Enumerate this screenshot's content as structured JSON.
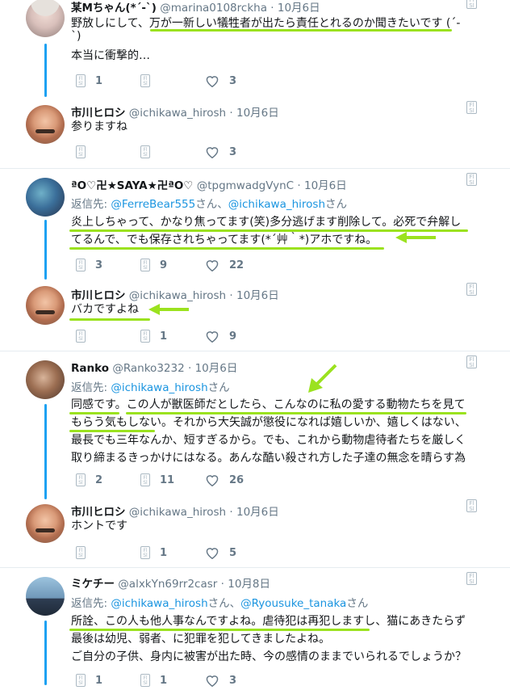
{
  "tweets": [
    {
      "name": "某Mちゃん(*´-`)",
      "handle": "@marina0108rckha",
      "date": "10月6日",
      "reply_prefix": "",
      "reply_users": [],
      "lines": [
        "野放しにして、万が一新しい犠牲者が出たら責任とれるのか聞きたいです (´-",
        "`)",
        "本当に衝撃的…"
      ],
      "reply_count": "1",
      "retweet_count": "",
      "like_count": "3"
    },
    {
      "name": "市川ヒロシ",
      "handle": "@ichikawa_hirosh",
      "date": "10月6日",
      "lines": [
        "参りますね"
      ],
      "reply_count": "",
      "retweet_count": "",
      "like_count": "3"
    },
    {
      "name": "ªO♡卍★SAYA★卍ªO♡",
      "handle": "@tpgmwadgVynC",
      "date": "10月6日",
      "reply_prefix": "返信先: ",
      "reply_users": [
        "@FerreBear555",
        "さん、",
        "@ichikawa_hirosh",
        "さん"
      ],
      "lines": [
        "炎上しちゃって、かなり焦ってます(笑)多分逃げます削除して。必死で弁解し",
        "てるんで、でも保存されちゃってます(*´艸｀*)アホですね。"
      ],
      "reply_count": "3",
      "retweet_count": "9",
      "like_count": "22"
    },
    {
      "name": "市川ヒロシ",
      "handle": "@ichikawa_hirosh",
      "date": "10月6日",
      "lines": [
        "バカですよね"
      ],
      "reply_count": "",
      "retweet_count": "1",
      "like_count": "9"
    },
    {
      "name": "Ranko",
      "handle": "@Ranko3232",
      "date": "10月6日",
      "reply_prefix": "返信先: ",
      "reply_users": [
        "@ichikawa_hirosh",
        "さん"
      ],
      "lines": [
        "同感です。この人が獣医師だとしたら、こんなのに私の愛する動物たちを見て",
        "もらう気もしない。それから大矢誠が懲役になれば嬉しいか、嬉しくはない、",
        "最長でも三年なんか、短すぎるから。でも、これから動物虐待者たちを厳しく",
        "取り締まるきっかけにはなる。あんな酷い殺され方した子達の無念を晴らす為"
      ],
      "reply_count": "2",
      "retweet_count": "11",
      "like_count": "26"
    },
    {
      "name": "市川ヒロシ",
      "handle": "@ichikawa_hirosh",
      "date": "10月6日",
      "lines": [
        "ホントです"
      ],
      "reply_count": "",
      "retweet_count": "1",
      "like_count": "5"
    },
    {
      "name": "ミケチー",
      "handle": "@alxkYn69rr2casr",
      "date": "10月8日",
      "reply_prefix": "返信先: ",
      "reply_users": [
        "@ichikawa_hirosh",
        "さん、",
        "@Ryousuke_tanaka",
        "さん"
      ],
      "lines": [
        "所詮、この人も他人事なんですよね。虐待犯は再犯しますし、猫にあきたらず",
        "最後は幼児、弱者、に犯罪を犯してきましたよね。",
        "ご自分の子供、身内に被害が出た時、今の感情のままでいられるでしょうか？"
      ],
      "reply_count": "1",
      "retweet_count": "1",
      "like_count": "3"
    }
  ],
  "icon_glyph": "Fl\nSl",
  "colors": {
    "link": "#1b95e0",
    "thread": "#1da1f2",
    "highlight": "#9be21f",
    "muted": "#657786"
  }
}
